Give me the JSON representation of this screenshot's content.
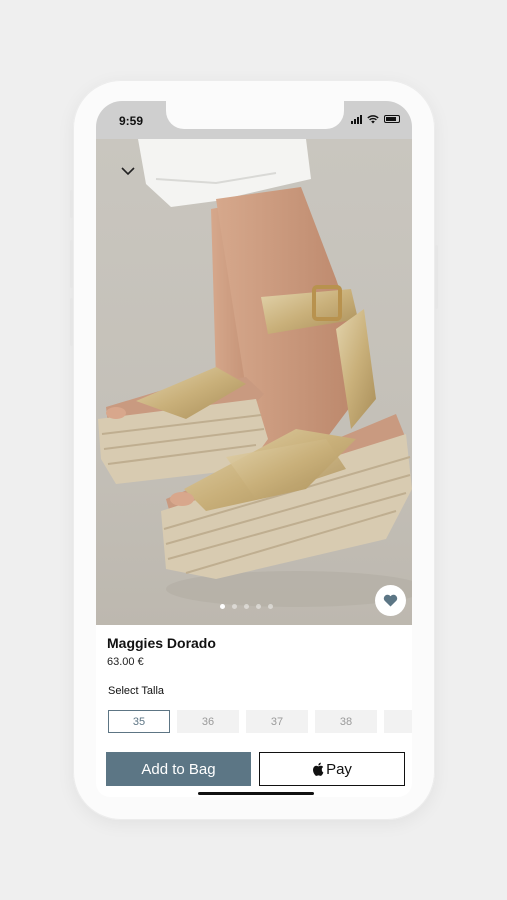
{
  "status_bar": {
    "time": "9:59"
  },
  "product": {
    "name": "Maggies Dorado",
    "price": "63.00 €",
    "image_pager": {
      "count": 5,
      "active_index": 0
    }
  },
  "size_selector": {
    "label": "Select Talla",
    "sizes": [
      "35",
      "36",
      "37",
      "38",
      "3"
    ],
    "selected": "35"
  },
  "actions": {
    "add_to_bag": "Add to Bag",
    "apple_pay": "Pay"
  },
  "colors": {
    "accent": "#5c7685",
    "background": "#efefef"
  }
}
